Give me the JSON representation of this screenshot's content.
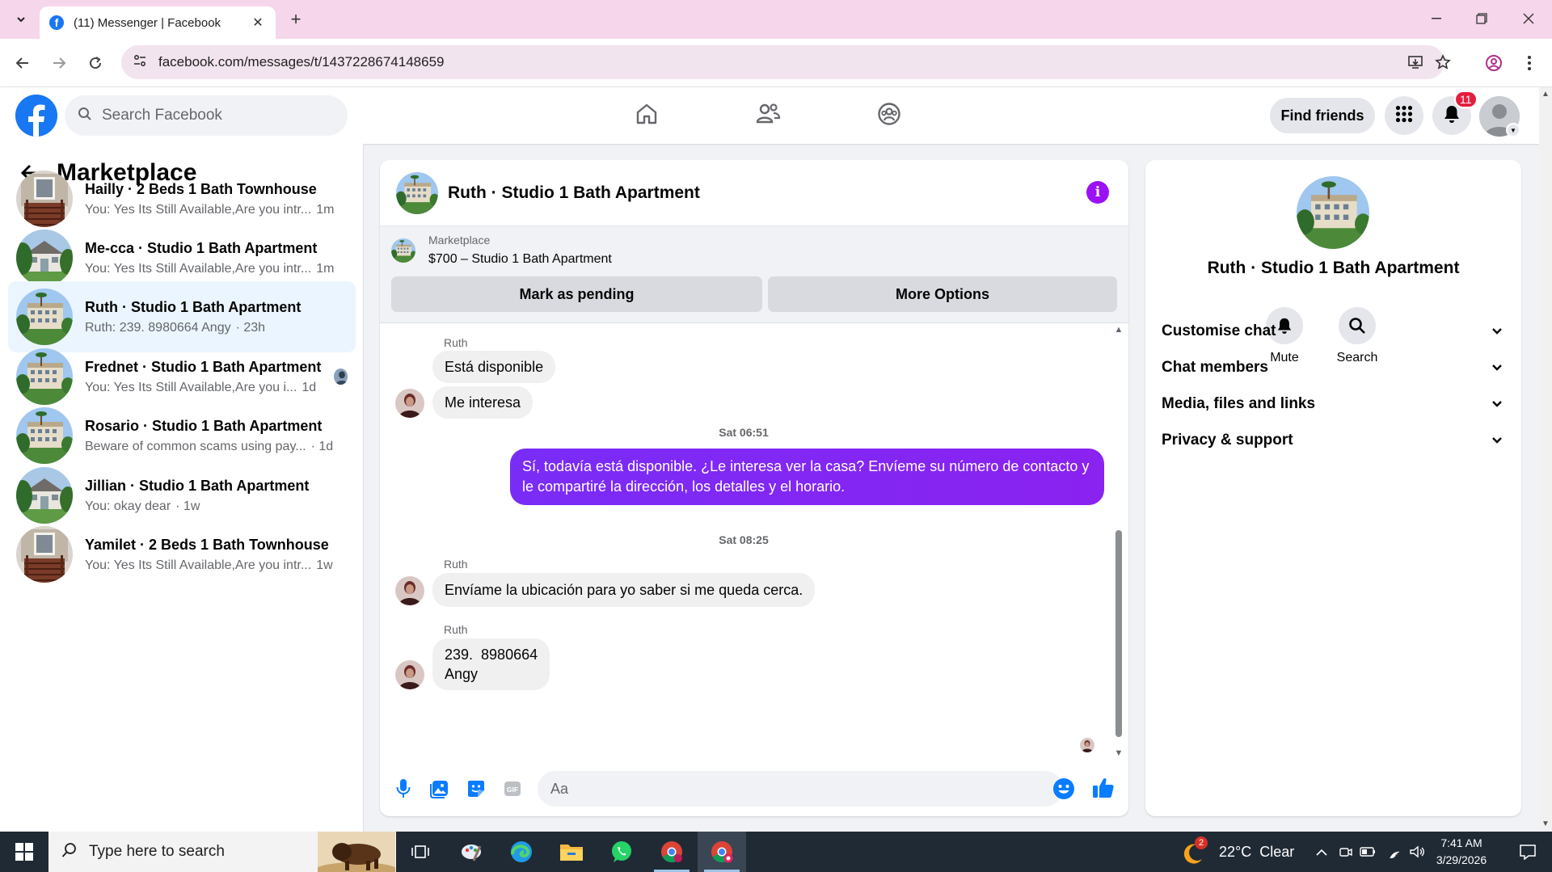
{
  "browser": {
    "tab_title": "(11) Messenger | Facebook",
    "url": "facebook.com/messages/t/1437228674148659"
  },
  "fb_header": {
    "search_placeholder": "Search Facebook",
    "find_friends_label": "Find friends",
    "notification_count": "11"
  },
  "sidebar": {
    "title": "Marketplace",
    "conversations": [
      {
        "name": "Hailly · 2 Beds 1 Bath Townhouse",
        "preview": "You: Yes Its Still Available,Are you intr...",
        "time": "1m",
        "thumb": "townhouse"
      },
      {
        "name": "Me-cca · Studio 1 Bath Apartment",
        "preview": "You: Yes Its Still Available,Are you intr...",
        "time": "1m",
        "thumb": "house-green"
      },
      {
        "name": "Ruth · Studio 1 Bath Apartment",
        "preview": "Ruth: 239. 8980664 Angy",
        "time": "· 23h",
        "thumb": "apartment"
      },
      {
        "name": "Frednet · Studio 1 Bath Apartment",
        "preview": "You: Yes Its Still Available,Are you i...",
        "time": "1d",
        "thumb": "apartment"
      },
      {
        "name": "Rosario · Studio 1 Bath Apartment",
        "preview": "Beware of common scams using pay...",
        "time": "· 1d",
        "thumb": "apartment"
      },
      {
        "name": "Jillian · Studio 1 Bath Apartment",
        "preview": "You: okay dear",
        "time": "· 1w",
        "thumb": "house-green"
      },
      {
        "name": "Yamilet · 2 Beds 1 Bath Townhouse",
        "preview": "You: Yes Its Still Available,Are you intr...",
        "time": "1w",
        "thumb": "townhouse"
      }
    ]
  },
  "chat": {
    "title": "Ruth · Studio 1 Bath Apartment",
    "marketplace_label": "Marketplace",
    "listing": "$700 – Studio 1 Bath Apartment",
    "mark_pending_label": "Mark as pending",
    "more_options_label": "More Options",
    "messages": {
      "sender_1": "Ruth",
      "in_1": "Está disponible",
      "in_2": "Me interesa",
      "time_1": "Sat 06:51",
      "out_1": "Sí, todavía está disponible. ¿Le interesa ver la casa? Envíeme su número de contacto y le compartiré la dirección, los detalles y el horario.",
      "time_2": "Sat 08:25",
      "sender_2": "Ruth",
      "in_3": "Envíame la ubicación para yo saber si me queda cerca.",
      "sender_3": "Ruth",
      "in_4_line1": "239.  8980664",
      "in_4_line2": "Angy"
    },
    "composer_placeholder": "Aa"
  },
  "info_panel": {
    "name": "Ruth · Studio 1 Bath Apartment",
    "mute_label": "Mute",
    "search_label": "Search",
    "sections": [
      "Customise chat",
      "Chat members",
      "Media, files and links",
      "Privacy & support"
    ]
  },
  "taskbar": {
    "search_placeholder": "Type here to search",
    "weather_badge": "2",
    "weather": "22°C  Clear",
    "time": "7:41 AM",
    "date": "3/29/2026"
  },
  "colors": {
    "fb_blue": "#1877f2",
    "messenger_purple": "#7a2cf7",
    "active_conv_bg": "#ebf5ff",
    "notif_red": "#e41e3f"
  }
}
